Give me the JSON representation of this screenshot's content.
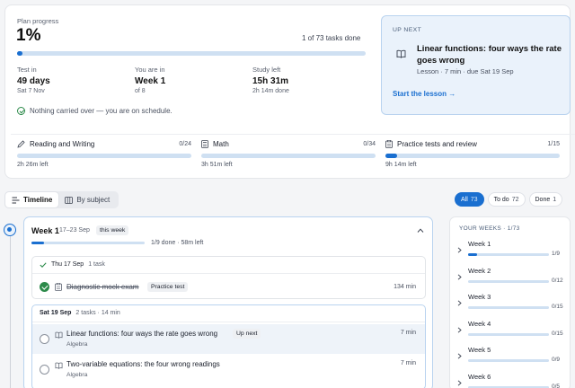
{
  "plan": {
    "label": "Plan progress",
    "percent": "1%",
    "progress_fraction": 0.01,
    "count": "1 of 73 tasks done",
    "stats": [
      {
        "key": "Test in",
        "value": "49 days",
        "sub": "Sat 7 Nov"
      },
      {
        "key": "You are in",
        "value": "Week 1",
        "sub": "of 8"
      },
      {
        "key": "Study left",
        "value": "15h 31m",
        "sub": "2h 14m done"
      }
    ],
    "carry": "Nothing carried over — you are on schedule."
  },
  "up_next": {
    "label": "UP NEXT",
    "title": "Linear functions: four ways the rate goes wrong",
    "meta": "Lesson · 7 min · due Sat 19 Sep",
    "link": "Start the lesson"
  },
  "subjects": [
    {
      "name": "Reading and Writing",
      "count": "0/24",
      "left": "2h 26m left",
      "fraction": 0,
      "icon": "pencil-icon"
    },
    {
      "name": "Math",
      "count": "0/34",
      "left": "3h 51m left",
      "fraction": 0,
      "icon": "calculator-icon"
    },
    {
      "name": "Practice tests and review",
      "count": "1/15",
      "left": "9h 14m left",
      "fraction": 0.067,
      "icon": "clipboard-icon"
    }
  ],
  "tabs": [
    {
      "label": "Timeline",
      "active": true
    },
    {
      "label": "By subject",
      "active": false
    }
  ],
  "filters": [
    {
      "label": "All",
      "count": "73",
      "active": true
    },
    {
      "label": "To do",
      "count": "72",
      "active": false
    },
    {
      "label": "Done",
      "count": "1",
      "active": false
    }
  ],
  "week": {
    "title": "Week 1",
    "dates": "17–23 Sep",
    "badge": "this week",
    "done": "1/9 done · 58m left",
    "fraction": 0.11,
    "days": [
      {
        "date": "Thu 17 Sep",
        "sub": "1 task",
        "tasks": [
          {
            "title": "Diagnostic mock exam",
            "tag": "Practice test",
            "minutes": "134 min",
            "done": true
          }
        ]
      },
      {
        "date": "Sat 19 Sep",
        "sub": "2 tasks · 14 min",
        "tasks": [
          {
            "title": "Linear functions: four ways the rate goes wrong",
            "sub": "Algebra",
            "tag": "Up next",
            "minutes": "7 min",
            "done": false
          },
          {
            "title": "Two-variable equations: the four wrong readings",
            "sub": "Algebra",
            "minutes": "7 min",
            "done": false
          }
        ]
      }
    ]
  },
  "your_weeks": {
    "label": "YOUR WEEKS · 1/73",
    "items": [
      {
        "name": "Week 1",
        "count": "1/9",
        "fraction": 0.11
      },
      {
        "name": "Week 2",
        "count": "0/12",
        "fraction": 0
      },
      {
        "name": "Week 3",
        "count": "0/15",
        "fraction": 0
      },
      {
        "name": "Week 4",
        "count": "0/15",
        "fraction": 0
      },
      {
        "name": "Week 5",
        "count": "0/9",
        "fraction": 0
      },
      {
        "name": "Week 6",
        "count": "0/5",
        "fraction": 0
      }
    ]
  },
  "colors": {
    "accent": "#1a6fd0",
    "success": "#2c8a4a",
    "track": "#cfe0f2"
  }
}
